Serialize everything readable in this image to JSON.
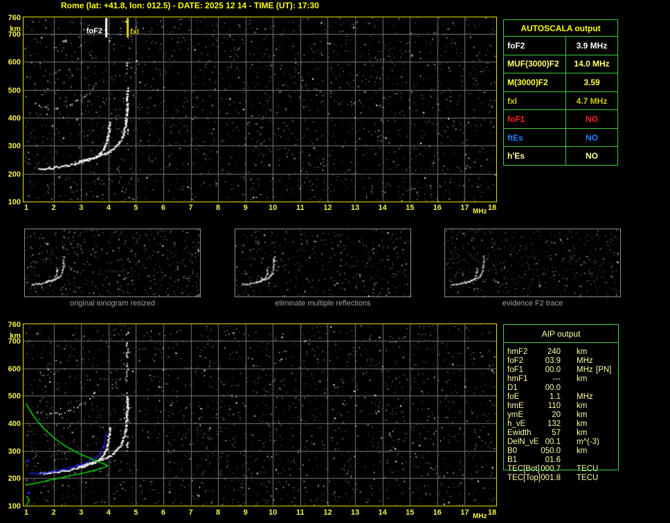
{
  "title": "Rome (lat: +41.8, lon: 012.5) - DATE: 2025 12 14 - TIME (UT): 17:30",
  "autoscala_table": {
    "title": "AUTOSCALA output",
    "rows": [
      {
        "label": "foF2",
        "value": "3.9 MHz",
        "color": "#ffffff"
      },
      {
        "label": "MUF(3000)F2",
        "value": "14.0 MHz",
        "color": "#ffff73"
      },
      {
        "label": "M(3000)F2",
        "value": "3.59",
        "color": "#ffff38"
      },
      {
        "label": "fxI",
        "value": "4.7 MHz",
        "color": "#c9c900"
      },
      {
        "label": "foF1",
        "value": "NO",
        "color": "#ff2020"
      },
      {
        "label": "ftEs",
        "value": "NO",
        "color": "#1e7fff"
      },
      {
        "label": "h'Es",
        "value": "NO",
        "color": "#ffff9e"
      }
    ]
  },
  "aip_table": {
    "title": "AIP output",
    "rows": [
      {
        "name": "hmF2",
        "value": "240",
        "unit": "km",
        "note": ""
      },
      {
        "name": "foF2",
        "value": "03.9",
        "unit": "MHz",
        "note": ""
      },
      {
        "name": "foF1",
        "value": "00.0",
        "unit": "MHz",
        "note": "[PN]"
      },
      {
        "name": "hmF1",
        "value": "---",
        "unit": "km",
        "note": ""
      },
      {
        "name": "D1",
        "value": "00.0",
        "unit": "",
        "note": ""
      },
      {
        "name": "foE",
        "value": "1.1",
        "unit": "MHz",
        "note": ""
      },
      {
        "name": "hmE",
        "value": "110",
        "unit": "km",
        "note": ""
      },
      {
        "name": "ymE",
        "value": "20",
        "unit": "km",
        "note": ""
      },
      {
        "name": "h_vE",
        "value": "132",
        "unit": "km",
        "note": ""
      },
      {
        "name": "Ewidth",
        "value": "57",
        "unit": "km",
        "note": ""
      },
      {
        "name": "DelN_vE",
        "value": "00.1",
        "unit": "m^(-3)",
        "note": ""
      },
      {
        "name": "B0",
        "value": "050.0",
        "unit": "km",
        "note": ""
      },
      {
        "name": "B1",
        "value": "01.6",
        "unit": "",
        "note": ""
      },
      {
        "name": "TEC[Bot]",
        "value": "000.7",
        "unit": "TECU",
        "note": ""
      },
      {
        "name": "TEC[Top]",
        "value": "001.8",
        "unit": "TECU",
        "note": ""
      }
    ]
  },
  "thumbnails": [
    {
      "caption": "original ionogram resized",
      "series": [
        "f2-ordinary-trace",
        "f2-extraordinary-trace",
        "multiple-reflection-trace",
        "third-hop-fragment",
        "spread-f-echo"
      ],
      "noise": 520,
      "dim": false
    },
    {
      "caption": "eliminate multiple reflections",
      "series": [
        "f2-ordinary-trace",
        "f2-extraordinary-trace",
        "spread-f-echo"
      ],
      "noise": 400,
      "dim": false
    },
    {
      "caption": "evidence F2 trace",
      "series": [
        "f2-ordinary-trace",
        "f2-extraordinary-trace"
      ],
      "noise": 650,
      "dim": true
    }
  ],
  "chart_data": [
    {
      "id": "autoscaled-ionogram",
      "type": "scatter",
      "title": "",
      "xlabel": "MHz",
      "ylabel": "km",
      "xlim": [
        1,
        18
      ],
      "ylim": [
        100,
        760
      ],
      "x_ticks": [
        1,
        2,
        3,
        4,
        5,
        6,
        7,
        8,
        9,
        10,
        11,
        12,
        13,
        14,
        15,
        16,
        17,
        18
      ],
      "y_ticks": [
        760,
        700,
        600,
        500,
        400,
        300,
        200,
        100
      ],
      "grid": true,
      "markers": [
        {
          "label": "foF2",
          "freq_mhz": 3.9,
          "color": "#ffffff"
        },
        {
          "label": "fxI",
          "freq_mhz": 4.7,
          "color": "#e0d800"
        }
      ],
      "series": [
        {
          "name": "f2-ordinary-trace",
          "color": "#ffffff",
          "style": "echo",
          "points": [
            [
              1.45,
              219
            ],
            [
              1.6,
              220
            ],
            [
              1.8,
              222
            ],
            [
              2.0,
              224
            ],
            [
              2.2,
              227
            ],
            [
              2.4,
              230
            ],
            [
              2.6,
              234
            ],
            [
              2.8,
              239
            ],
            [
              3.0,
              244
            ],
            [
              3.2,
              250
            ],
            [
              3.4,
              258
            ],
            [
              3.55,
              266
            ],
            [
              3.7,
              276
            ],
            [
              3.8,
              289
            ],
            [
              3.88,
              305
            ],
            [
              3.93,
              323
            ],
            [
              3.97,
              345
            ],
            [
              4.0,
              368
            ],
            [
              4.02,
              390
            ]
          ]
        },
        {
          "name": "f2-extraordinary-trace",
          "color": "#ffffff",
          "style": "echo",
          "points": [
            [
              2.9,
              247
            ],
            [
              3.1,
              251
            ],
            [
              3.3,
              256
            ],
            [
              3.5,
              262
            ],
            [
              3.7,
              269
            ],
            [
              3.9,
              277
            ],
            [
              4.1,
              288
            ],
            [
              4.25,
              300
            ],
            [
              4.38,
              315
            ],
            [
              4.48,
              333
            ],
            [
              4.55,
              355
            ],
            [
              4.6,
              380
            ],
            [
              4.63,
              408
            ],
            [
              4.65,
              440
            ],
            [
              4.66,
              472
            ],
            [
              4.67,
              505
            ]
          ]
        },
        {
          "name": "multiple-reflection-trace",
          "color": "#d0d0d0",
          "style": "echo-sparse",
          "points": [
            [
              1.25,
              452
            ],
            [
              1.45,
              444
            ],
            [
              1.65,
              439
            ],
            [
              1.85,
              436
            ],
            [
              2.05,
              437
            ],
            [
              2.25,
              440
            ],
            [
              2.45,
              446
            ],
            [
              2.65,
              453
            ],
            [
              2.85,
              462
            ],
            [
              3.05,
              473
            ],
            [
              3.25,
              488
            ],
            [
              3.4,
              505
            ],
            [
              3.52,
              525
            ],
            [
              3.62,
              548
            ]
          ]
        },
        {
          "name": "third-hop-fragment",
          "color": "#d0d0d0",
          "style": "echo-sparse",
          "points": [
            [
              2.2,
              664
            ],
            [
              2.32,
              673
            ],
            [
              2.42,
              681
            ],
            [
              2.5,
              690
            ]
          ]
        },
        {
          "name": "spread-f-echo",
          "color": "#ffffff",
          "style": "vspread",
          "density": 0.3,
          "points": [
            [
              4.66,
              300
            ],
            [
              4.66,
              755
            ]
          ]
        }
      ]
    },
    {
      "id": "profile-ionogram",
      "type": "scatter",
      "title": "",
      "xlabel": "MHz",
      "ylabel": "km",
      "xlim": [
        1,
        18
      ],
      "ylim": [
        100,
        760
      ],
      "x_ticks": [
        1,
        2,
        3,
        4,
        5,
        6,
        7,
        8,
        9,
        10,
        11,
        12,
        13,
        14,
        15,
        16,
        17,
        18
      ],
      "y_ticks": [
        760,
        700,
        600,
        500,
        400,
        300,
        200,
        100
      ],
      "grid": true,
      "series": [
        {
          "name": "f2-ordinary-trace",
          "color": "#ffffff",
          "style": "echo",
          "points": [
            [
              1.45,
              219
            ],
            [
              1.6,
              220
            ],
            [
              1.8,
              222
            ],
            [
              2.0,
              224
            ],
            [
              2.2,
              227
            ],
            [
              2.4,
              230
            ],
            [
              2.6,
              234
            ],
            [
              2.8,
              239
            ],
            [
              3.0,
              244
            ],
            [
              3.2,
              250
            ],
            [
              3.4,
              258
            ],
            [
              3.55,
              266
            ],
            [
              3.7,
              276
            ],
            [
              3.8,
              289
            ],
            [
              3.88,
              305
            ],
            [
              3.93,
              323
            ],
            [
              3.97,
              345
            ],
            [
              4.0,
              368
            ],
            [
              4.02,
              390
            ]
          ]
        },
        {
          "name": "f2-extraordinary-trace",
          "color": "#ffffff",
          "style": "echo",
          "points": [
            [
              2.9,
              247
            ],
            [
              3.1,
              251
            ],
            [
              3.3,
              256
            ],
            [
              3.5,
              262
            ],
            [
              3.7,
              269
            ],
            [
              3.9,
              277
            ],
            [
              4.1,
              288
            ],
            [
              4.25,
              300
            ],
            [
              4.38,
              315
            ],
            [
              4.48,
              333
            ],
            [
              4.55,
              355
            ],
            [
              4.6,
              380
            ],
            [
              4.63,
              408
            ],
            [
              4.65,
              440
            ],
            [
              4.66,
              472
            ],
            [
              4.67,
              505
            ]
          ]
        },
        {
          "name": "multiple-reflection-trace",
          "color": "#d0d0d0",
          "style": "echo-sparse",
          "points": [
            [
              1.25,
              452
            ],
            [
              1.45,
              444
            ],
            [
              1.65,
              439
            ],
            [
              1.85,
              436
            ],
            [
              2.05,
              437
            ],
            [
              2.25,
              440
            ],
            [
              2.45,
              446
            ],
            [
              2.65,
              453
            ],
            [
              2.85,
              462
            ],
            [
              3.05,
              473
            ],
            [
              3.25,
              488
            ],
            [
              3.4,
              505
            ],
            [
              3.52,
              525
            ],
            [
              3.62,
              548
            ]
          ]
        },
        {
          "name": "third-hop-fragment",
          "color": "#d0d0d0",
          "style": "echo-sparse",
          "points": [
            [
              2.2,
              664
            ],
            [
              2.32,
              673
            ],
            [
              2.42,
              681
            ],
            [
              2.5,
              690
            ]
          ]
        },
        {
          "name": "spread-f-echo",
          "color": "#ffffff",
          "style": "vspread",
          "density": 0.55,
          "points": [
            [
              4.66,
              300
            ],
            [
              4.66,
              755
            ]
          ]
        },
        {
          "name": "restored-trace",
          "color": "#2424ff",
          "style": "plus",
          "points": [
            [
              1.15,
              218
            ],
            [
              1.3,
              217
            ],
            [
              1.5,
              218
            ],
            [
              1.7,
              220
            ],
            [
              1.9,
              223
            ],
            [
              2.1,
              226
            ],
            [
              2.3,
              230
            ],
            [
              2.5,
              235
            ],
            [
              2.7,
              240
            ],
            [
              2.9,
              246
            ],
            [
              3.1,
              253
            ],
            [
              3.3,
              261
            ],
            [
              3.45,
              270
            ],
            [
              3.6,
              281
            ],
            [
              3.72,
              295
            ],
            [
              3.81,
              312
            ],
            [
              3.87,
              331
            ],
            [
              3.91,
              352
            ],
            [
              3.93,
              366
            ]
          ]
        },
        {
          "name": "restored-trace-isolated-points",
          "color": "#2424ff",
          "style": "points",
          "points": [
            [
              1.05,
              264
            ],
            [
              1.08,
              148
            ]
          ]
        },
        {
          "name": "electron-density-profile",
          "color": "#00d400",
          "style": "line",
          "points": [
            [
              1.0,
              472
            ],
            [
              1.1,
              452
            ],
            [
              1.25,
              428
            ],
            [
              1.45,
              402
            ],
            [
              1.65,
              380
            ],
            [
              1.9,
              356
            ],
            [
              2.15,
              336
            ],
            [
              2.4,
              319
            ],
            [
              2.65,
              304
            ],
            [
              2.9,
              291
            ],
            [
              3.15,
              280
            ],
            [
              3.35,
              271
            ],
            [
              3.55,
              263
            ],
            [
              3.72,
              257
            ],
            [
              3.85,
              252
            ],
            [
              3.95,
              247
            ],
            [
              3.9,
              242
            ],
            [
              3.78,
              237
            ],
            [
              3.58,
              231
            ],
            [
              3.35,
              225
            ],
            [
              3.1,
              219
            ],
            [
              2.85,
              214
            ],
            [
              2.6,
              209
            ],
            [
              2.35,
              203
            ],
            [
              2.1,
              198
            ],
            [
              1.85,
              193
            ],
            [
              1.6,
              187
            ],
            [
              1.35,
              182
            ],
            [
              1.15,
              178
            ],
            [
              1.0,
              175
            ]
          ]
        },
        {
          "name": "e-layer-profile",
          "color": "#00d400",
          "style": "line",
          "points": [
            [
              1.0,
              134
            ],
            [
              1.06,
              128
            ],
            [
              1.1,
              121
            ],
            [
              1.08,
              113
            ],
            [
              1.03,
              106
            ],
            [
              1.0,
              101
            ]
          ]
        }
      ]
    }
  ]
}
